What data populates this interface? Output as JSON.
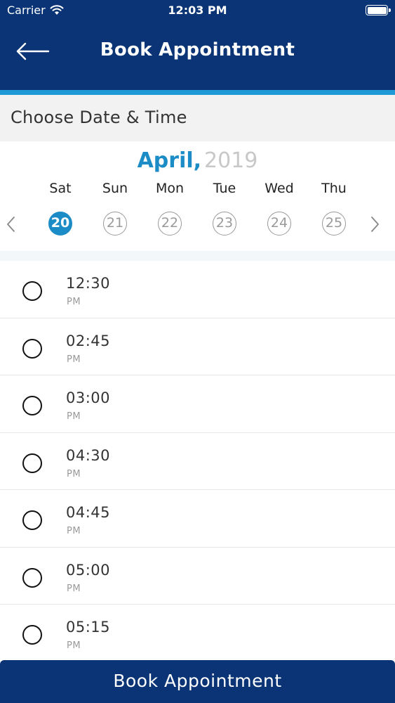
{
  "status_bar": {
    "carrier": "Carrier",
    "time": "12:03 PM",
    "wifi_icon": "wifi-icon",
    "battery_icon": "battery-icon"
  },
  "header": {
    "back_icon": "arrow-left-icon",
    "title": "Book Appointment",
    "background": "#0a3475",
    "accent": "#1f9ad6"
  },
  "section": {
    "title": "Choose Date & Time"
  },
  "calendar": {
    "month": "April,",
    "year": "2019",
    "month_color": "#1c8cc7",
    "prev_icon": "chevron-left-icon",
    "next_icon": "chevron-right-icon",
    "days": [
      {
        "name": "Sat",
        "number": "20",
        "selected": true
      },
      {
        "name": "Sun",
        "number": "21",
        "selected": false
      },
      {
        "name": "Mon",
        "number": "22",
        "selected": false
      },
      {
        "name": "Tue",
        "number": "23",
        "selected": false
      },
      {
        "name": "Wed",
        "number": "24",
        "selected": false
      },
      {
        "name": "Thu",
        "number": "25",
        "selected": false
      }
    ]
  },
  "slots": [
    {
      "time": "12:30",
      "period": "PM",
      "selected": false
    },
    {
      "time": "02:45",
      "period": "PM",
      "selected": false
    },
    {
      "time": "03:00",
      "period": "PM",
      "selected": false
    },
    {
      "time": "04:30",
      "period": "PM",
      "selected": false
    },
    {
      "time": "04:45",
      "period": "PM",
      "selected": false
    },
    {
      "time": "05:00",
      "period": "PM",
      "selected": false
    },
    {
      "time": "05:15",
      "period": "PM",
      "selected": false
    }
  ],
  "footer": {
    "book_label": "Book Appointment"
  }
}
